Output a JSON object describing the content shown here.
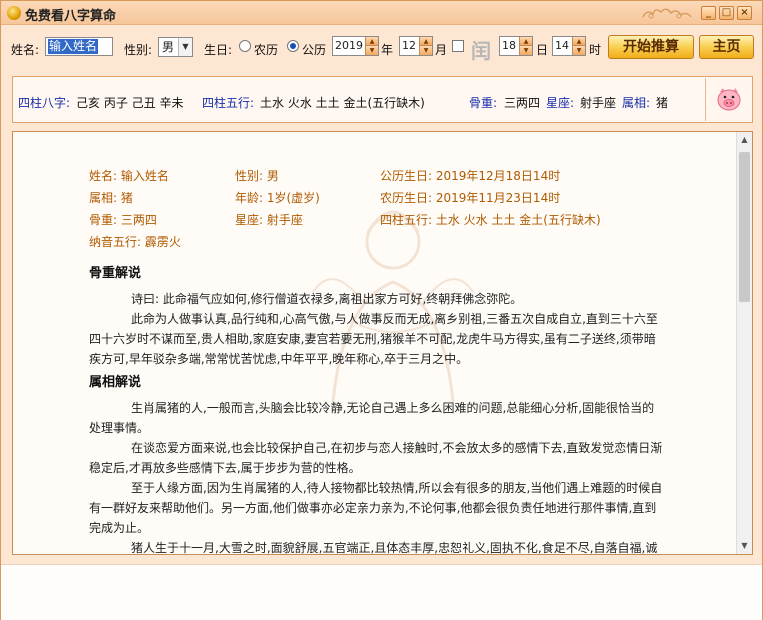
{
  "window": {
    "title": "免费看八字算命",
    "minimize": "_",
    "maximize": "□",
    "close": "×"
  },
  "toolbar": {
    "name_label": "姓名:",
    "name_value": "输入姓名",
    "gender_label": "性别:",
    "gender_value": "男",
    "birthday_label": "生日:",
    "lunar_label": "农历",
    "solar_label": "公历",
    "calendar_selected": "公历",
    "year_value": "2019",
    "year_unit": "年",
    "month_value": "12",
    "month_unit": "月",
    "leap_glyph": "闰",
    "day_value": "18",
    "day_unit": "日",
    "hour_value": "14",
    "hour_unit": "时",
    "start_button": "开始推算",
    "home_button": "主页"
  },
  "summary": {
    "bazi_label": "四柱八字:",
    "bazi_value": "己亥 丙子 己丑 辛未",
    "wuxing_label": "四柱五行:",
    "wuxing_value": "土水 火水 土土 金土(五行缺木)",
    "weight_label": "骨重:",
    "weight_value": "三两四",
    "star_label": "星座:",
    "star_value": "射手座",
    "zodiac_label": "属相:",
    "zodiac_value": "猪",
    "zodiac_icon": "pig-icon"
  },
  "result": {
    "fields": {
      "name": "姓名: 输入姓名",
      "gender": "性别: 男",
      "solar_birth": "公历生日: 2019年12月18日14时",
      "zodiac": "属相: 猪",
      "age": "年龄: 1岁(虚岁)",
      "lunar_birth": "农历生日: 2019年11月23日14时",
      "weight": "骨重: 三两四",
      "constellation": "星座: 射手座",
      "wuxing": "四柱五行: 土水 火水 土土 金土(五行缺木)",
      "nayin": "纳音五行: 霹雳火"
    },
    "weight_section_title": "骨重解说",
    "weight_poem": "诗曰: 此命福气应如何,修行僧道衣禄多,离祖出家方可好,终朝拜佛念弥陀。",
    "weight_text": "此命为人做事认真,品行纯和,心高气傲,与人做事反而无成,离乡别祖,三番五次自成自立,直到三十六至四十六岁时不谋而至,贵人相助,家庭安康,妻宫若要无刑,猪猴羊不可配,龙虎牛马方得实,虽有二子送终,须带暗疾方可,早年驳杂多端,常常忧苦忧虑,中年平平,晚年称心,卒于三月之中。",
    "zodiac_section_title": "属相解说",
    "zodiac_p1": "生肖属猪的人,一般而言,头脑会比较冷静,无论自己遇上多么困难的问题,总能细心分析,固能很恰当的处理事情。",
    "zodiac_p2": "在谈恋爱方面来说,也会比较保护自己,在初步与恋人接触时,不会放太多的感情下去,直致发觉恋情日渐稳定后,才再放多些感情下去,属于步步为营的性格。",
    "zodiac_p3": "至于人缘方面,因为生肖属猪的人,待人接物都比较热情,所以会有很多的朋友,当他们遇上难题的时候自有一群好友来帮助他们。另一方面,他们做事亦必定亲力亲为,不论何事,他都会很负责任地进行那件事情,直到完成为止。",
    "zodiac_p4": "猪人生于十一月,大雪之时,面貌舒展,五官端正,且体态丰厚,忠恕礼义,固执不化,食足不尽,自落自福,诚发其身,名利两全,一世不犯天秋。"
  },
  "colors": {
    "accent": "#f2a860",
    "label_blue": "#1a2fa8",
    "field_orange": "#b05a00"
  }
}
